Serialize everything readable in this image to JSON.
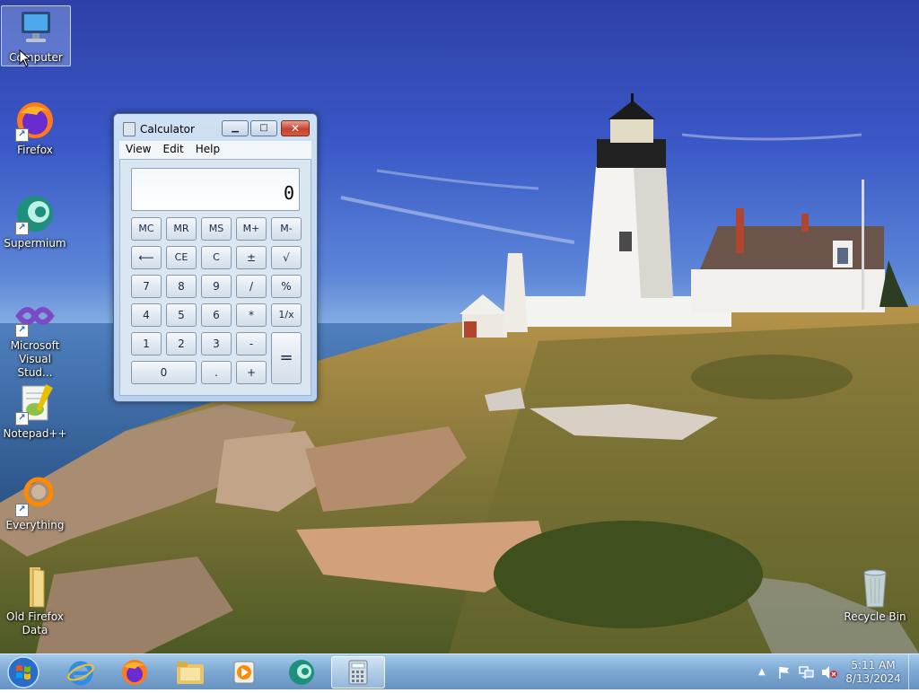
{
  "desktop": {
    "icons": [
      {
        "label": "Computer",
        "icon": "computer-icon"
      },
      {
        "label": "Firefox",
        "icon": "firefox-icon"
      },
      {
        "label": "Supermium",
        "icon": "supermium-icon"
      },
      {
        "label": "Microsoft Visual Stud...",
        "icon": "visual-studio-icon"
      },
      {
        "label": "Notepad++",
        "icon": "notepad-plus-plus-icon"
      },
      {
        "label": "Everything",
        "icon": "everything-icon"
      },
      {
        "label": "Old Firefox Data",
        "icon": "folder-icon"
      },
      {
        "label": "Recycle Bin",
        "icon": "recycle-bin-icon"
      }
    ]
  },
  "calculator": {
    "title": "Calculator",
    "menu": [
      "View",
      "Edit",
      "Help"
    ],
    "display": "0",
    "keys": {
      "mc": "MC",
      "mr": "MR",
      "ms": "MS",
      "mplus": "M+",
      "mminus": "M-",
      "back": "⟵",
      "ce": "CE",
      "c": "C",
      "plusminus": "±",
      "sqrt": "√",
      "n7": "7",
      "n8": "8",
      "n9": "9",
      "div": "/",
      "pct": "%",
      "n4": "4",
      "n5": "5",
      "n6": "6",
      "mul": "*",
      "recip": "1/x",
      "n1": "1",
      "n2": "2",
      "n3": "3",
      "sub": "-",
      "eq": "=",
      "n0": "0",
      "dot": ".",
      "add": "+"
    }
  },
  "taskbar": {
    "pinned": [
      "internet-explorer-icon",
      "firefox-icon",
      "file-explorer-icon",
      "media-player-icon",
      "supermium-icon",
      "calculator-icon"
    ],
    "clock_time": "5:11 AM",
    "clock_date": "8/13/2024",
    "tray_icons": [
      "show-hidden-icons-icon",
      "action-center-flag-icon",
      "network-icon",
      "volume-muted-icon"
    ]
  },
  "colors": {
    "accent": "#1f5ec8",
    "close": "#c5422d"
  }
}
